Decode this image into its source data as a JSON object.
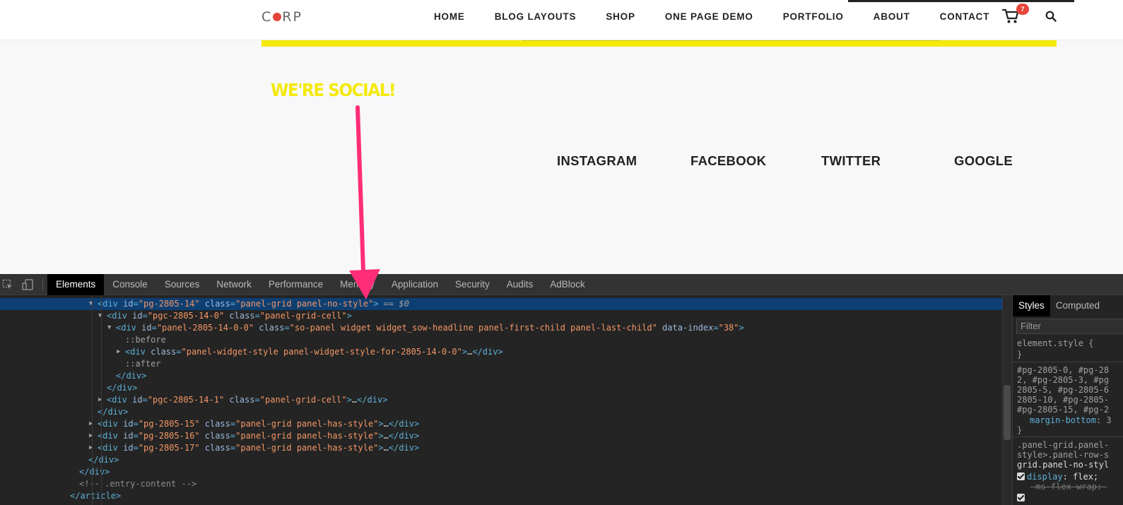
{
  "site": {
    "logo": {
      "before": "C",
      "after": "RP"
    },
    "nav": [
      "HOME",
      "BLOG LAYOUTS",
      "SHOP",
      "ONE PAGE DEMO",
      "PORTFOLIO",
      "ABOUT",
      "CONTACT"
    ],
    "cart_count": "7",
    "social_heading": "WE'RE SOCIAL!",
    "social_links": [
      "INSTAGRAM",
      "FACEBOOK",
      "TWITTER",
      "GOOGLE"
    ],
    "colors": {
      "accent_yellow": "#f4e90a",
      "badge_red": "#e8453c",
      "arrow_pink": "#ff2d78"
    }
  },
  "devtools": {
    "tabs": [
      "Elements",
      "Console",
      "Sources",
      "Network",
      "Performance",
      "Memory",
      "Application",
      "Security",
      "Audits",
      "AdBlock"
    ],
    "active_tab": "Elements",
    "dom_lines": [
      {
        "indent": 0,
        "toggle": "down",
        "tag": "div",
        "attrs": [
          [
            "id",
            "pg-2805-14"
          ],
          [
            "class",
            "panel-grid panel-no-style"
          ]
        ],
        "selected": true,
        "suffix": " == $0"
      },
      {
        "indent": 1,
        "toggle": "down",
        "tag": "div",
        "attrs": [
          [
            "id",
            "pgc-2805-14-0"
          ],
          [
            "class",
            "panel-grid-cell"
          ]
        ]
      },
      {
        "indent": 2,
        "toggle": "down",
        "tag": "div",
        "attrs": [
          [
            "id",
            "panel-2805-14-0-0"
          ],
          [
            "class",
            "so-panel widget widget_sow-headline panel-first-child panel-last-child"
          ],
          [
            "data-index",
            "38"
          ]
        ]
      },
      {
        "indent": 3,
        "pseudo": "::before"
      },
      {
        "indent": 3,
        "toggle": "right",
        "tag": "div",
        "attrs": [
          [
            "class",
            "panel-widget-style panel-widget-style-for-2805-14-0-0"
          ]
        ],
        "collapsed": true
      },
      {
        "indent": 3,
        "pseudo": "::after"
      },
      {
        "indent": 2,
        "close": "div"
      },
      {
        "indent": 1,
        "close": "div"
      },
      {
        "indent": 1,
        "toggle": "right",
        "tag": "div",
        "attrs": [
          [
            "id",
            "pgc-2805-14-1"
          ],
          [
            "class",
            "panel-grid-cell"
          ]
        ],
        "collapsed": true
      },
      {
        "indent": 0,
        "close": "div"
      },
      {
        "indent": 0,
        "toggle": "right",
        "tag": "div",
        "attrs": [
          [
            "id",
            "pg-2805-15"
          ],
          [
            "class",
            "panel-grid panel-has-style"
          ]
        ],
        "collapsed": true
      },
      {
        "indent": 0,
        "toggle": "right",
        "tag": "div",
        "attrs": [
          [
            "id",
            "pg-2805-16"
          ],
          [
            "class",
            "panel-grid panel-has-style"
          ]
        ],
        "collapsed": true
      },
      {
        "indent": 0,
        "toggle": "right",
        "tag": "div",
        "attrs": [
          [
            "id",
            "pg-2805-17"
          ],
          [
            "class",
            "panel-grid panel-has-style"
          ]
        ],
        "collapsed": true
      },
      {
        "indent": -1,
        "close": "div"
      },
      {
        "indent": -2,
        "close": "div"
      },
      {
        "indent": -2,
        "comment": "<!-- .entry-content -->"
      },
      {
        "indent": -3,
        "close": "article"
      }
    ],
    "styles": {
      "tabs": [
        "Styles",
        "Computed"
      ],
      "filter_placeholder": "Filter",
      "element_style_open": "element.style {",
      "element_style_close": "}",
      "rule1_lines": [
        "#pg-2805-0, #pg-28",
        "2, #pg-2805-3, #pg",
        "2805-5, #pg-2805-6",
        "2805-10, #pg-2805-",
        "#pg-2805-15, #pg-2"
      ],
      "rule1_prop": "margin-bottom",
      "rule1_close": "}",
      "rule2_lines": [
        ".panel-grid.panel-",
        "style>.panel-row-s",
        "grid.panel-no-styl"
      ],
      "rule2_prop": "display",
      "rule2_val": "flex;",
      "rule2_struck": "-ms-flex-wrap: "
    }
  }
}
